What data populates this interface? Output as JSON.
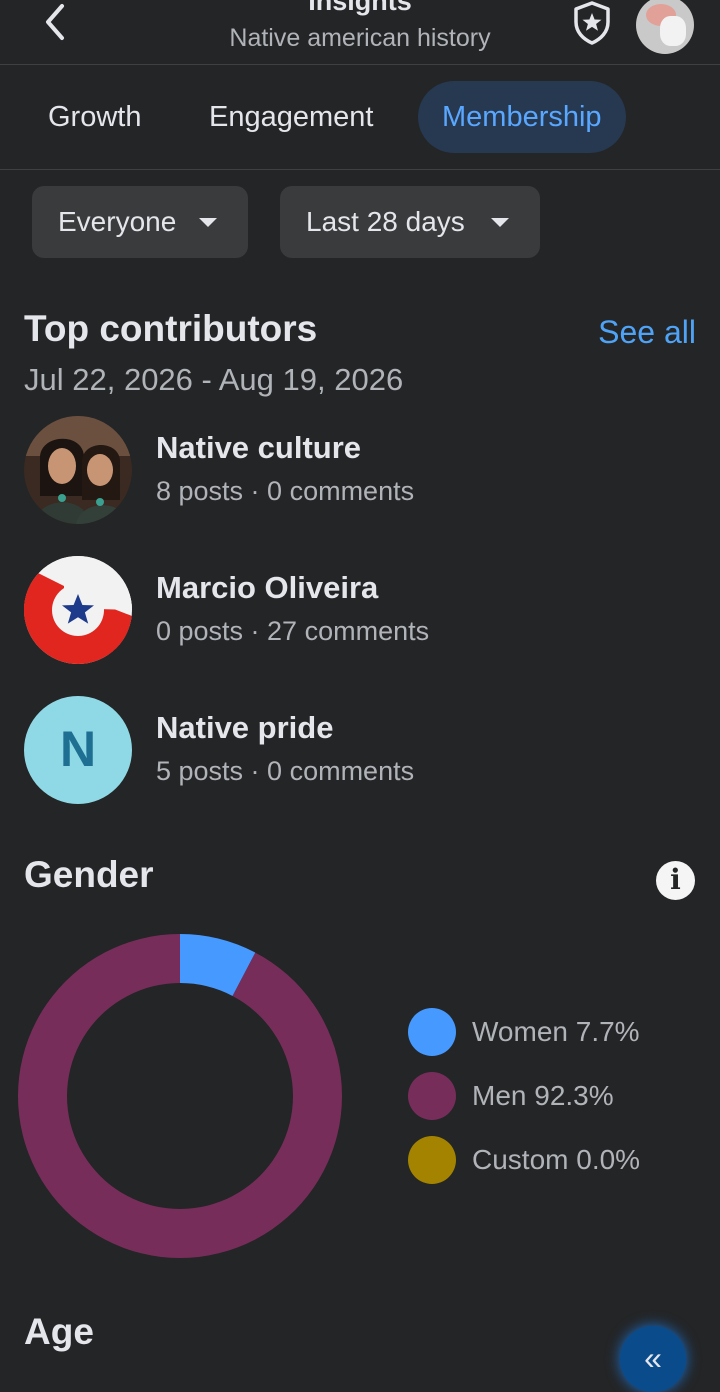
{
  "header": {
    "title": "Insights",
    "subtitle": "Native american history"
  },
  "tabs": [
    {
      "label": "Growth",
      "active": false
    },
    {
      "label": "Engagement",
      "active": false
    },
    {
      "label": "Membership",
      "active": true
    }
  ],
  "filters": {
    "audience": "Everyone",
    "period": "Last 28 days"
  },
  "top_contributors": {
    "title": "Top contributors",
    "see_all": "See all",
    "date_range": "Jul 22, 2026 - Aug 19, 2026",
    "items": [
      {
        "name": "Native culture",
        "stats": "8 posts · 0 comments",
        "avatar": "photo"
      },
      {
        "name": "Marcio Oliveira",
        "stats": "0 posts · 27 comments",
        "avatar": "flag"
      },
      {
        "name": "Native pride",
        "stats": "5 posts · 0 comments",
        "avatar": "letter",
        "initial": "N"
      }
    ]
  },
  "gender": {
    "title": "Gender",
    "legend": [
      {
        "label": "Women 7.7%",
        "color": "#4599ff"
      },
      {
        "label": "Men 92.3%",
        "color": "#772d5a"
      },
      {
        "label": "Custom 0.0%",
        "color": "#a38300"
      }
    ]
  },
  "age": {
    "title": "Age"
  },
  "chart_data": {
    "type": "pie",
    "title": "Gender",
    "categories": [
      "Women",
      "Men",
      "Custom"
    ],
    "values": [
      7.7,
      92.3,
      0.0
    ],
    "colors": [
      "#4599ff",
      "#772d5a",
      "#a38300"
    ],
    "legend": "right"
  },
  "colors": {
    "background": "#242526",
    "accent": "#4fa3f7",
    "active_tab_bg": "#263951"
  }
}
